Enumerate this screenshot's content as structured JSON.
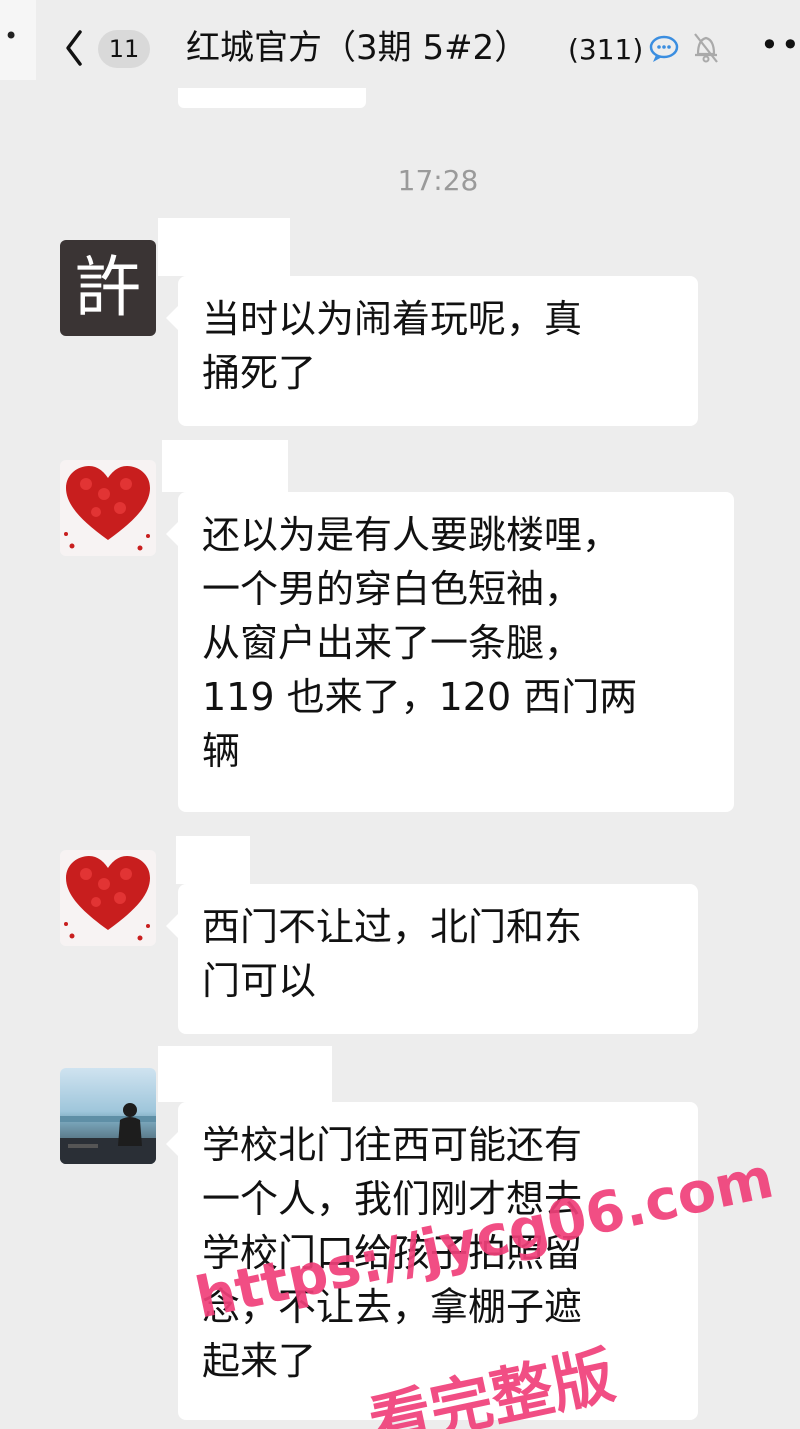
{
  "header": {
    "unread_count": "11",
    "title": "红城官方（3期 5#2）",
    "member_count": "(311)",
    "more_label": "•••"
  },
  "timestamp": "17:28",
  "messages": [
    {
      "avatar": "許",
      "avatar_type": "calligraphy-character",
      "text": "当时以为闹着玩呢，真\n捅死了"
    },
    {
      "avatar": "",
      "avatar_type": "red-rose-heart",
      "text": "还以为是有人要跳楼哩，\n一个男的穿白色短袖，\n从窗户出来了一条腿，\n119 也来了，120 西门两\n辆"
    },
    {
      "avatar": "",
      "avatar_type": "red-rose-heart",
      "text": "西门不让过，北门和东\n门可以"
    },
    {
      "avatar": "",
      "avatar_type": "seaside-photo",
      "text": "学校北门往西可能还有\n一个人，我们刚才想去\n学校门口给孩子拍照留\n念，不让去，拿棚子遮\n起来了"
    }
  ],
  "watermark": {
    "url": "https://jycg06.com",
    "text": "看完整版",
    "color": "#f0407a"
  },
  "colors": {
    "background": "#ededed",
    "bubble": "#ffffff",
    "timestamp": "#9a9a9a",
    "chat_icon_blue": "#3b8ee0"
  }
}
